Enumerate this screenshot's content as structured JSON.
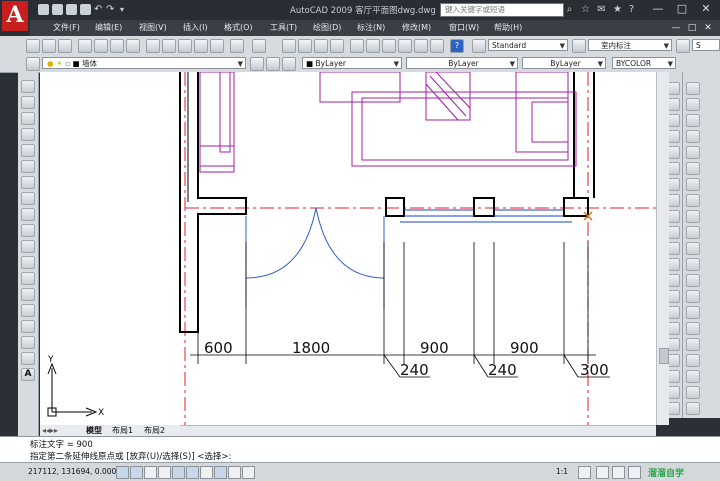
{
  "app": {
    "logo_letter": "A",
    "title": "AutoCAD 2009  客厅平面图dwg.dwg",
    "search_placeholder": "键入关键字或短语",
    "window_controls": [
      "—",
      "□",
      "✕"
    ]
  },
  "menu": {
    "items": [
      "文件(F)",
      "编辑(E)",
      "视图(V)",
      "插入(I)",
      "格式(O)",
      "工具(T)",
      "绘图(D)",
      "标注(N)",
      "修改(M)",
      "窗口(W)",
      "帮助(H)"
    ],
    "mdi_controls": [
      "—",
      "□",
      "✕"
    ]
  },
  "toolbar_standard": {
    "text_style": "Standard",
    "dim_style": "室内标注",
    "table_style_prefix": "S"
  },
  "toolbar_layers": {
    "layer": "墙体",
    "color": "ByLayer",
    "linetype": "ByLayer",
    "lineweight": "ByLayer",
    "plotstyle": "BYCOLOR"
  },
  "drawing": {
    "dim_labels": [
      "600",
      "1800",
      "900",
      "900",
      "240",
      "240",
      "300"
    ],
    "ucs_x": "X",
    "ucs_y": "Y"
  },
  "tabs": {
    "model": "模型",
    "layout1": "布局1",
    "layout2": "布局2"
  },
  "command": {
    "line1": "标注文字 = 900",
    "line2": "指定第二条延伸线原点或 [放弃(U)/选择(S)] <选择>:"
  },
  "status": {
    "coords": "217112, 131694, 0.0000",
    "scale": "1:1",
    "watermark": "溜溜自学"
  },
  "colors": {
    "wall": "#000000",
    "furniture": "#a020a0",
    "dimension": "#1a44c8",
    "axis": "#e0202a",
    "door": "#3060d0"
  }
}
